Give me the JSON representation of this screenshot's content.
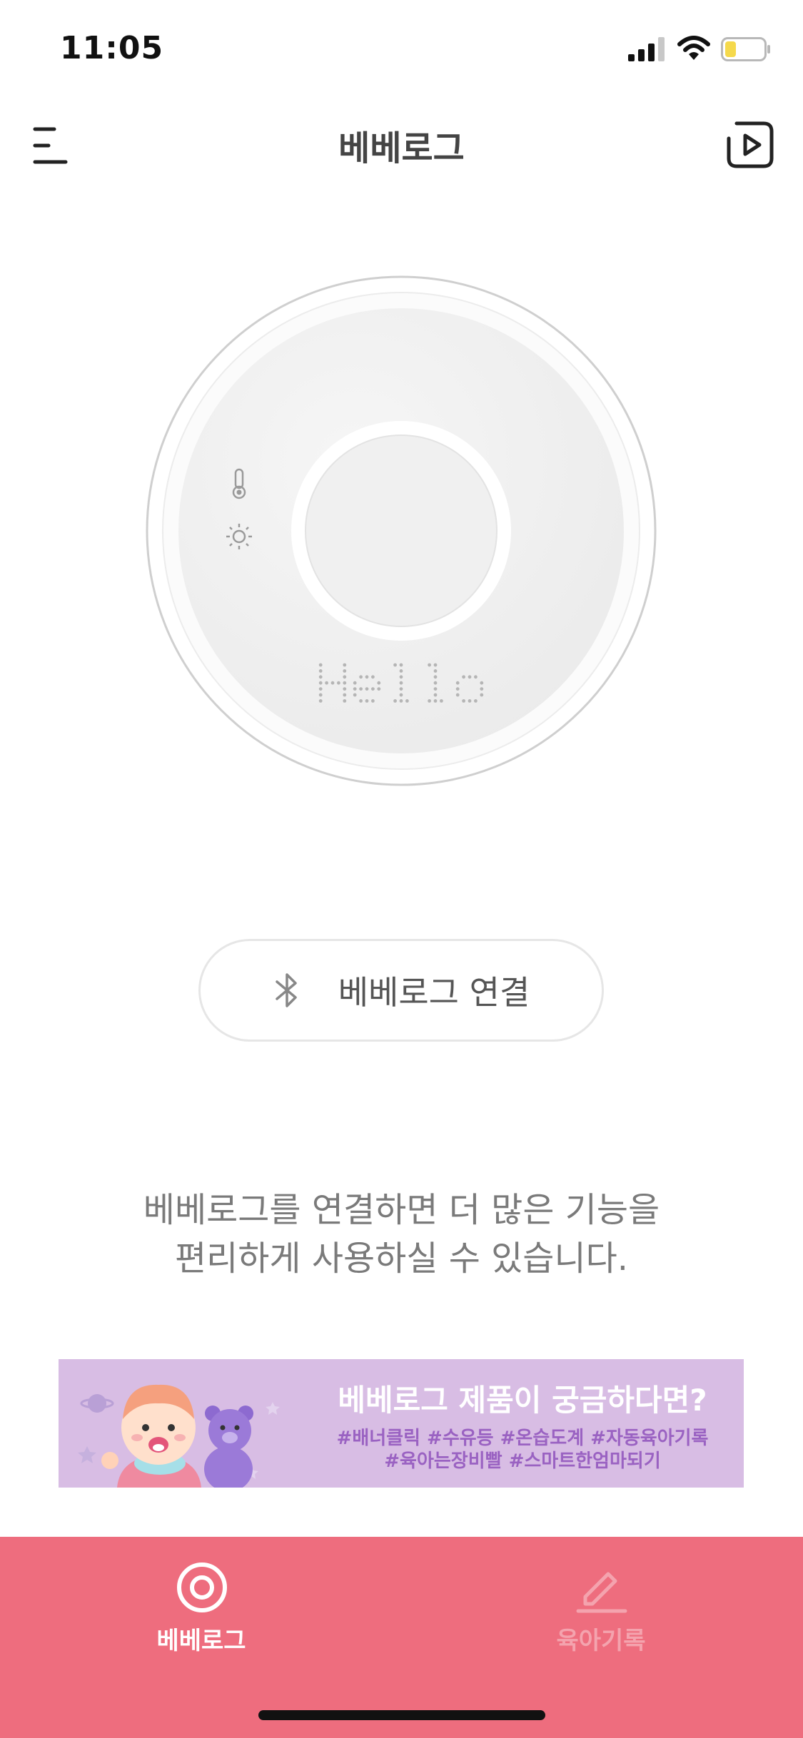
{
  "status_bar": {
    "time": "11:05",
    "icons": [
      "signal-icon",
      "wifi-icon",
      "battery-icon"
    ],
    "battery_color": "#f5d94c"
  },
  "header": {
    "title": "베베로그",
    "left_icon": "menu-icon",
    "right_icon": "video-play-icon"
  },
  "device": {
    "display_text": "Hello",
    "icons": [
      "thermometer-icon",
      "brightness-icon"
    ]
  },
  "connect_button": {
    "label": "베베로그 연결",
    "icon": "bluetooth-icon"
  },
  "description": {
    "line1": "베베로그를 연결하면 더 많은 기능을",
    "line2": "편리하게 사용하실 수 있습니다."
  },
  "banner": {
    "title": "베베로그 제품이 궁금하다면?",
    "tags_line1": "#배너클릭 #수유등 #온습도계 #자동육아기록",
    "tags_line2": "#육아는장비빨 #스마트한엄마되기",
    "background_color": "#d8bde4"
  },
  "bottom_nav": {
    "background_color": "#ee6d7e",
    "items": [
      {
        "label": "베베로그",
        "icon": "target-icon",
        "active": true
      },
      {
        "label": "육아기록",
        "icon": "pencil-icon",
        "active": false
      }
    ]
  }
}
